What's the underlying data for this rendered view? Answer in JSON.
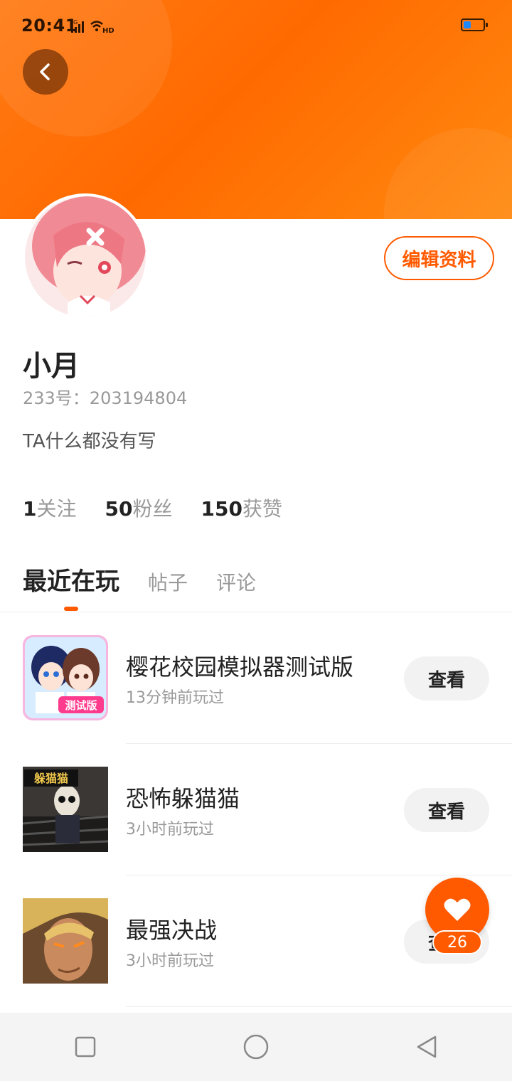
{
  "status_bar": {
    "time": "20:41",
    "network": "4G",
    "hd": "HD"
  },
  "colors": {
    "accent": "#ff5a00",
    "header_gradient_start": "#ff7a14",
    "header_gradient_end": "#ff8a10"
  },
  "header": {
    "back_icon": "chevron-left-icon"
  },
  "profile": {
    "edit_label": "编辑资料",
    "name": "小月",
    "uid": "233号：203194804",
    "bio": "TA什么都没有写",
    "stats": [
      {
        "value": "1",
        "label": "关注"
      },
      {
        "value": "50",
        "label": "粉丝"
      },
      {
        "value": "150",
        "label": "获赞"
      }
    ]
  },
  "tabs": [
    {
      "label": "最近在玩",
      "active": true
    },
    {
      "label": "帖子",
      "active": false
    },
    {
      "label": "评论",
      "active": false
    }
  ],
  "games": [
    {
      "title": "樱花校园模拟器测试版",
      "subtitle": "13分钟前玩过",
      "button": "查看",
      "icon_badge": "测试版"
    },
    {
      "title": "恐怖躲猫猫",
      "subtitle": "3小时前玩过",
      "button": "查看",
      "icon_badge": "躲猫猫"
    },
    {
      "title": "最强决战",
      "subtitle": "3小时前玩过",
      "button": "查看"
    }
  ],
  "like_fab": {
    "count": "26",
    "icon": "heart-icon"
  },
  "nav_bar": {
    "items": [
      "square-icon",
      "circle-icon",
      "triangle-back-icon"
    ]
  }
}
